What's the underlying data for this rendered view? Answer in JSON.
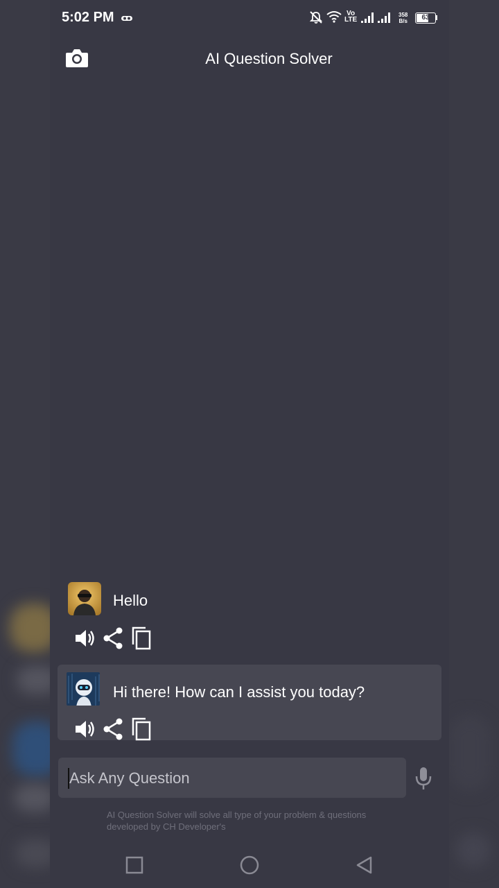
{
  "status_bar": {
    "time": "5:02 PM",
    "net_speed_value": "358",
    "net_speed_unit": "B/s",
    "battery": "63",
    "volte": "Vo",
    "lte": "LTE"
  },
  "header": {
    "title": "AI Question Solver",
    "camera_icon": "camera-icon"
  },
  "messages": [
    {
      "sender": "user",
      "text": "Hello"
    },
    {
      "sender": "bot",
      "text": "Hi there! How can I assist you today?"
    }
  ],
  "input": {
    "placeholder": "Ask Any Question",
    "value": ""
  },
  "footer_note": {
    "line1": "AI Question Solver will solve all type of your problem & questions",
    "line2": "developed by CH Developer's"
  },
  "colors": {
    "background": "#383844",
    "card": "#474752",
    "muted_text": "#6f6f7b"
  }
}
